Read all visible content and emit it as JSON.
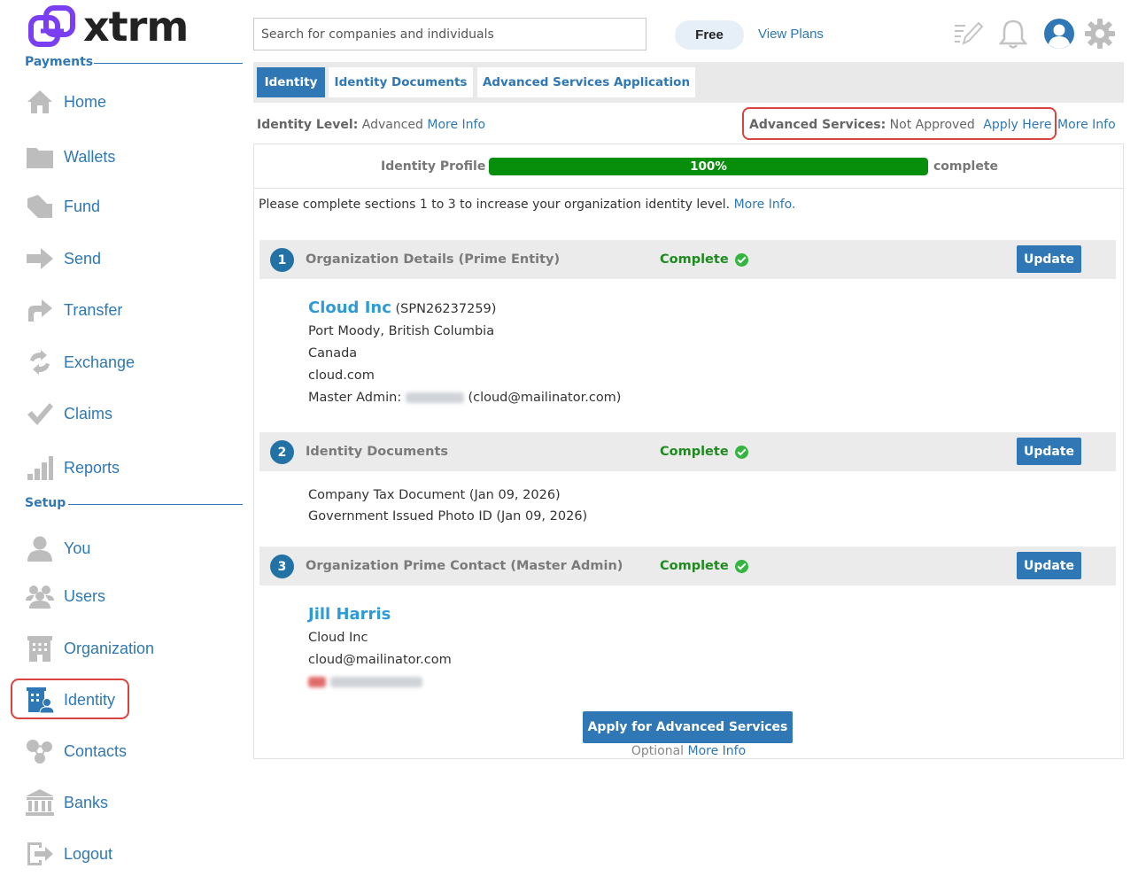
{
  "brand": {
    "name": "xtrm",
    "accent": "#7a3ff2"
  },
  "sidebar": {
    "payments_label": "Payments",
    "setup_label": "Setup",
    "payments_items": [
      {
        "label": "Home",
        "icon": "home-icon"
      },
      {
        "label": "Wallets",
        "icon": "folder-icon"
      },
      {
        "label": "Fund",
        "icon": "fund-icon"
      },
      {
        "label": "Send",
        "icon": "arrow-right-icon"
      },
      {
        "label": "Transfer",
        "icon": "transfer-icon"
      },
      {
        "label": "Exchange",
        "icon": "exchange-icon"
      },
      {
        "label": "Claims",
        "icon": "check-icon"
      },
      {
        "label": "Reports",
        "icon": "bar-chart-icon"
      }
    ],
    "setup_items": [
      {
        "label": "You",
        "icon": "user-icon"
      },
      {
        "label": "Users",
        "icon": "users-icon"
      },
      {
        "label": "Organization",
        "icon": "building-icon"
      },
      {
        "label": "Identity",
        "icon": "identity-icon",
        "active": true
      },
      {
        "label": "Contacts",
        "icon": "contacts-icon"
      },
      {
        "label": "Banks",
        "icon": "bank-icon"
      },
      {
        "label": "Logout",
        "icon": "logout-icon"
      }
    ]
  },
  "header": {
    "search_placeholder": "Search for companies and individuals",
    "plan": "Free",
    "view_plans": "View Plans"
  },
  "tabs": [
    {
      "label": "Identity",
      "active": true
    },
    {
      "label": "Identity Documents",
      "active": false
    },
    {
      "label": "Advanced Services Application",
      "active": false
    }
  ],
  "identity_level": {
    "label": "Identity Level:",
    "value": "Advanced",
    "more_info": "More Info"
  },
  "advanced_services": {
    "label": "Advanced Services:",
    "value": "Not Approved",
    "apply": "Apply Here",
    "more_info": "More Info"
  },
  "profile": {
    "label": "Identity Profile",
    "percent_text": "100%",
    "percent": 100,
    "suffix": "complete"
  },
  "instructions": {
    "text": "Please complete sections 1 to 3 to increase your organization identity level.",
    "link": "More Info."
  },
  "sections": [
    {
      "num": "1",
      "title": "Organization Details (Prime Entity)",
      "status": "Complete",
      "button": "Update",
      "name": "Cloud Inc",
      "name_suffix": "(SPN26237259)",
      "lines": [
        "Port Moody, British Columbia",
        "Canada",
        "cloud.com"
      ],
      "admin_label": "Master Admin:",
      "admin_email": "(cloud@mailinator.com)"
    },
    {
      "num": "2",
      "title": "Identity Documents",
      "status": "Complete",
      "button": "Update",
      "lines": [
        "Company Tax Document (Jan 09, 2026)",
        "Government Issued Photo ID (Jan 09, 2026)"
      ]
    },
    {
      "num": "3",
      "title": "Organization Prime Contact (Master Admin)",
      "status": "Complete",
      "button": "Update",
      "name": "Jill Harris",
      "lines": [
        "Cloud Inc",
        "cloud@mailinator.com"
      ]
    }
  ],
  "apply_button": "Apply for Advanced Services",
  "optional": {
    "label": "Optional",
    "link": "More Info"
  }
}
